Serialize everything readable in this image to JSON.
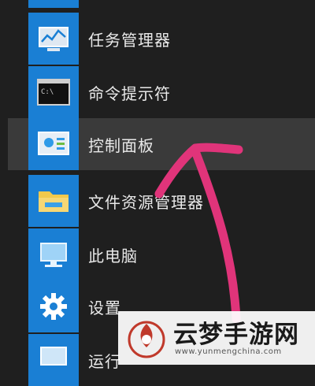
{
  "menu": {
    "items": [
      {
        "label": "任务管理器",
        "icon": "task-manager-icon"
      },
      {
        "label": "命令提示符",
        "icon": "command-prompt-icon"
      },
      {
        "label": "控制面板",
        "icon": "control-panel-icon",
        "highlighted": true
      },
      {
        "label": "文件资源管理器",
        "icon": "file-explorer-icon"
      },
      {
        "label": "此电脑",
        "icon": "this-pc-icon"
      },
      {
        "label": "设置",
        "icon": "settings-gear-icon"
      },
      {
        "label": "运行",
        "icon": "run-icon"
      }
    ]
  },
  "annotation": {
    "arrow_color": "#e0347a"
  },
  "watermark": {
    "title": "云梦手游网",
    "url": "www.yunmengchina.com"
  },
  "colors": {
    "tile_blue": "#1a7fd4",
    "menu_bg": "#1f1f1f",
    "highlight_bg": "#3a3a3a"
  }
}
